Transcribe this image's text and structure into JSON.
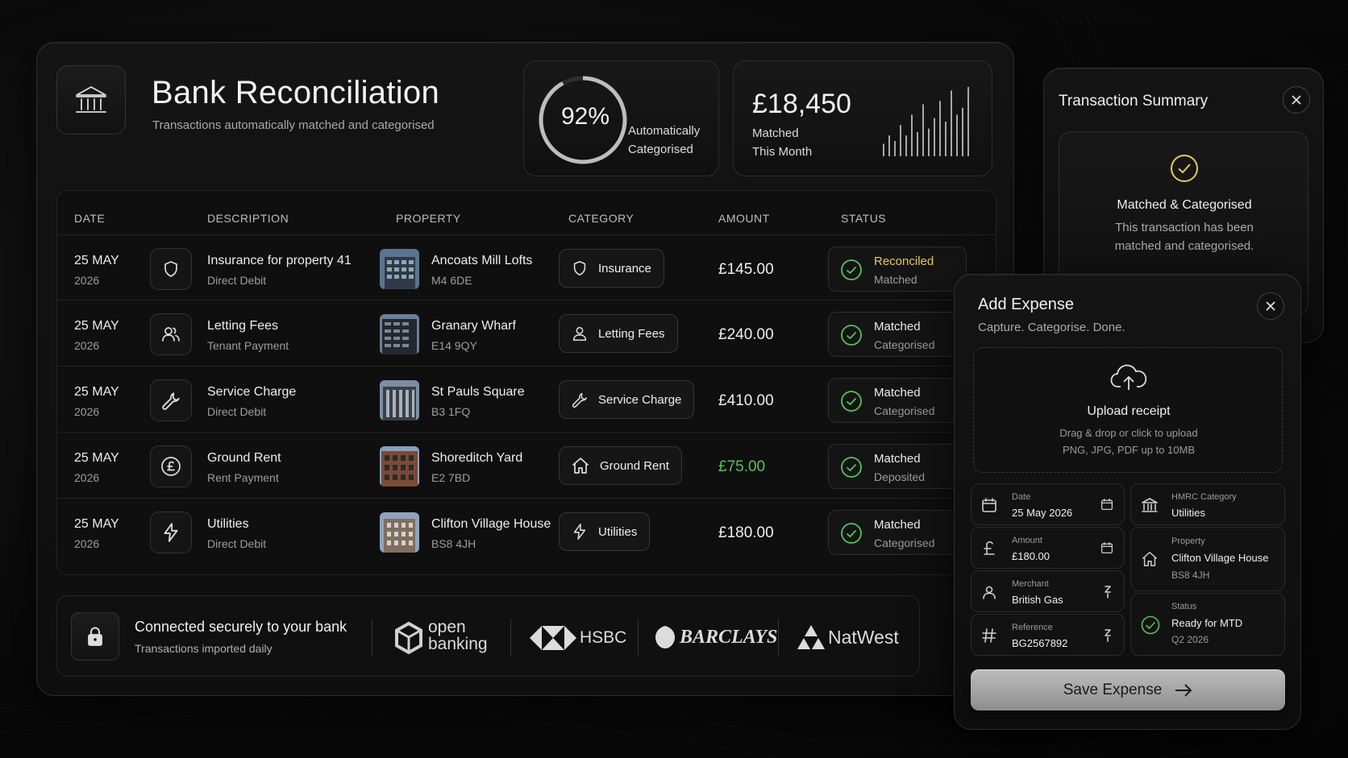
{
  "main": {
    "title": "Bank Reconciliation",
    "subtitle": "Transactions automatically matched and categorised",
    "auto_percent": "92%",
    "auto_fraction": 0.92,
    "auto_label_1": "Automatically",
    "auto_label_2": "Categorised",
    "matched_amount": "£18,450",
    "matched_label_1": "Matched",
    "matched_label_2": "This Month",
    "spark_values": [
      0.18,
      0.3,
      0.22,
      0.45,
      0.3,
      0.6,
      0.35,
      0.75,
      0.4,
      0.55,
      0.8,
      0.5,
      0.95,
      0.6,
      0.7,
      1.0
    ]
  },
  "table": {
    "headers": {
      "date": "DATE",
      "description": "DESCRIPTION",
      "property": "PROPERTY",
      "category": "CATEGORY",
      "amount": "AMOUNT",
      "status": "STATUS"
    },
    "rows": [
      {
        "day": "25 MAY",
        "year": "2026",
        "icon": "shield-icon",
        "desc": "Insurance for property 41",
        "desc_sub": "Direct Debit",
        "property": "Ancoats Mill Lofts",
        "postcode": "M4 6DE",
        "category": "Insurance",
        "cat_icon": "shield-icon",
        "amount": "£145.00",
        "status": "Reconciled",
        "status_sub": "Matched"
      },
      {
        "day": "25 MAY",
        "year": "2026",
        "icon": "users-icon",
        "desc": "Letting Fees",
        "desc_sub": "Tenant Payment",
        "property": "Granary Wharf",
        "postcode": "E14 9QY",
        "category": "Letting Fees",
        "cat_icon": "user-icon",
        "amount": "£240.00",
        "status": "Matched",
        "status_sub": "Categorised"
      },
      {
        "day": "25 MAY",
        "year": "2026",
        "icon": "wrench-icon",
        "desc": "Service Charge",
        "desc_sub": "Direct Debit",
        "property": "St Pauls Square",
        "postcode": "B3 1FQ",
        "category": "Service Charge",
        "cat_icon": "wrench-icon",
        "amount": "£410.00",
        "status": "Matched",
        "status_sub": "Categorised"
      },
      {
        "day": "25 MAY",
        "year": "2026",
        "icon": "pound-icon",
        "desc": "Ground Rent",
        "desc_sub": "Rent Payment",
        "property": "Shoreditch Yard",
        "postcode": "E2 7BD",
        "category": "Ground Rent",
        "cat_icon": "house-icon",
        "amount": "£75.00",
        "status": "Matched",
        "status_sub": "Deposited"
      },
      {
        "day": "25 MAY",
        "year": "2026",
        "icon": "bolt-icon",
        "desc": "Utilities",
        "desc_sub": "Direct Debit",
        "property": "Clifton Village House",
        "postcode": "BS8 4JH",
        "category": "Utilities",
        "cat_icon": "bolt-icon",
        "amount": "£180.00",
        "status": "Matched",
        "status_sub": "Categorised"
      }
    ]
  },
  "bank": {
    "title": "Connected securely to your bank",
    "sub": "Transactions imported daily",
    "logos": {
      "open_1": "open",
      "open_2": "banking",
      "hsbc": "HSBC",
      "barclays": "BARCLAYS",
      "natwest": "NatWest"
    }
  },
  "summary": {
    "title": "Transaction Summary",
    "status_title": "Matched & Categorised",
    "status_line_1": "This transaction has been",
    "status_line_2": "matched and categorised."
  },
  "expense": {
    "title": "Add Expense",
    "subtitle": "Capture. Categorise. Done.",
    "upload_title": "Upload receipt",
    "upload_line_1": "Drag & drop or click to upload",
    "upload_line_2": "PNG, JPG, PDF up to 10MB",
    "date_label": "Date",
    "date_value": "25 May 2026",
    "amount_label": "Amount",
    "amount_value": "£180.00",
    "merchant_label": "Merchant",
    "merchant_value": "British Gas",
    "reference_label": "Reference",
    "reference_value": "BG2567892",
    "hmrc_label": "HMRC Category",
    "hmrc_value": "Utilities",
    "property_label": "Property",
    "property_value": "Clifton Village House",
    "property_sub": "BS8 4JH",
    "status_label": "Status",
    "status_value": "Ready for MTD",
    "status_sub": "Q2 2026",
    "save_label": "Save Expense"
  },
  "colors": {
    "accent_yellow": "#e8c95a",
    "green": "#57c25a",
    "status_ring": "#7fbf6a"
  }
}
